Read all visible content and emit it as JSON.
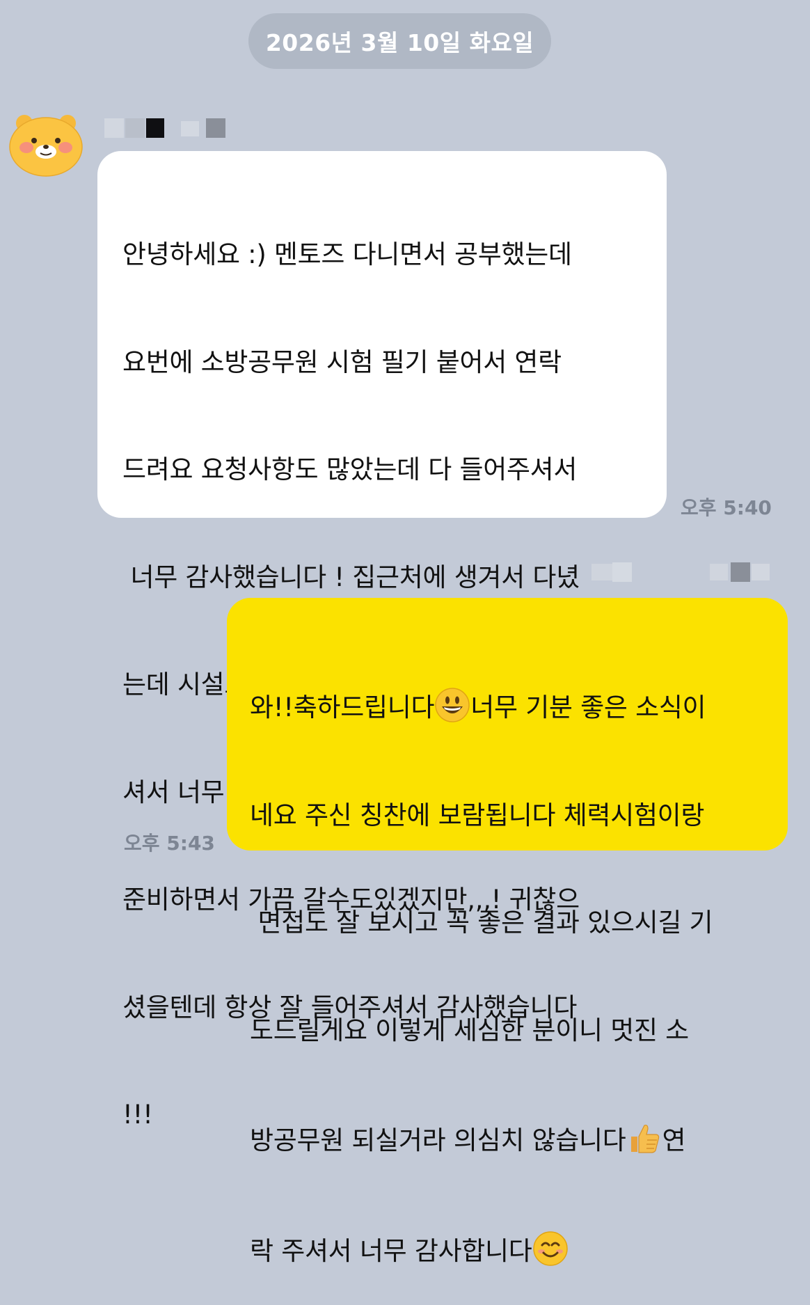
{
  "date_divider": "2026년 3월 10일 화요일",
  "incoming": {
    "sender_avatar_icon": "ryan-cat-avatar-icon",
    "lines": [
      "안녕하세요 :) 멘토즈 다니면서 공부했는데",
      "요번에 소방공무원 시험 필기 붙어서 연락",
      "드려요 요청사항도 많았는데 다 들어주셔서",
      " 너무 감사했습니다 ! 집근처에 생겨서 다녔",
      "는데 시설도 좋고 깔끔했고 관리도 잘해주",
      "셔서 너무 감사했어요 이제 체력이랑 면접",
      "준비하면서 가끔 갈수도있겠지만,,,! 귀찮으",
      "셨을텐데 항상 잘 들어주셔서 감사했습니다",
      "!!!"
    ],
    "time": "오후 5:40"
  },
  "outgoing": {
    "lines": [
      {
        "before": "와!!축하드립니다",
        "emoji": "grinning-face-icon",
        "after": "너무 기분 좋은 소식이"
      },
      {
        "before": "네요 주신 칭찬에 보람됩니다 체력시험이랑",
        "emoji": "",
        "after": ""
      },
      {
        "before": " 면접도 잘 보시고 꼭 좋은 결과 있으시길 기",
        "emoji": "",
        "after": ""
      },
      {
        "before": "도드릴게요 이렇게 세심한 분이니 멋진 소",
        "emoji": "",
        "after": ""
      },
      {
        "before": "방공무원 되실거라 의심치 않습니다",
        "emoji": "thumbs-up-icon",
        "after": "연"
      },
      {
        "before": "락 주셔서 너무 감사합니다",
        "emoji": "smiling-face-icon",
        "after": ""
      }
    ],
    "time": "오후 5:43"
  },
  "colors": {
    "background": "#c3cad7",
    "incoming_bubble": "#ffffff",
    "outgoing_bubble": "#fbe200",
    "date_pill": "#b0b8c5",
    "time_text": "#7d8593"
  }
}
